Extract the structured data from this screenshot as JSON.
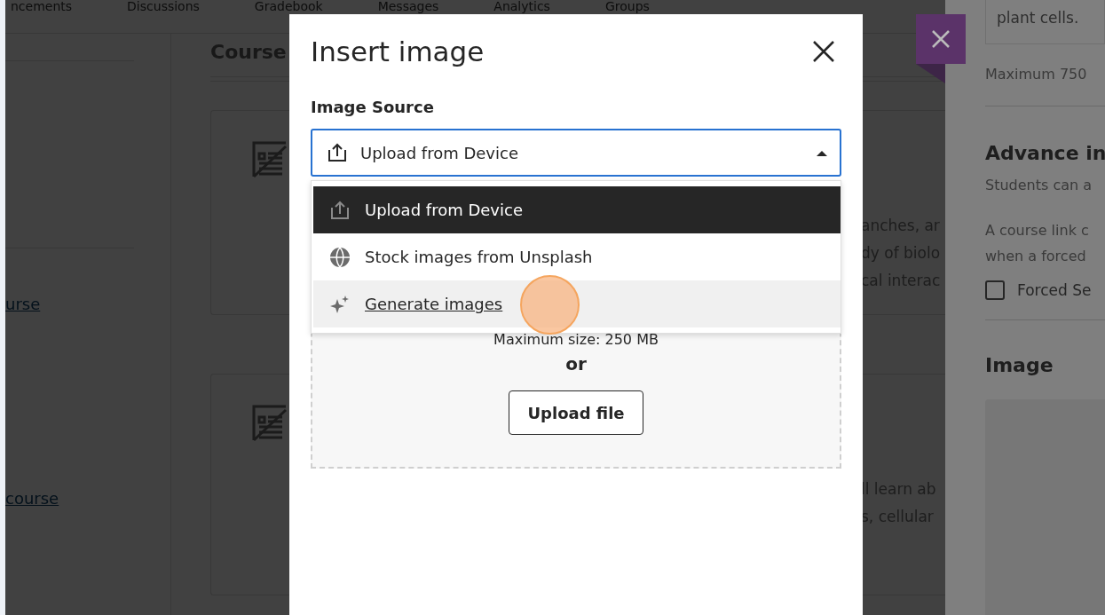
{
  "top_tabs": [
    "ncements",
    "Discussions",
    "Gradebook",
    "Messages",
    "Analytics",
    "Groups"
  ],
  "sidebar": {
    "links": [
      "urse",
      "course"
    ]
  },
  "main": {
    "heading": "Course",
    "cards": [
      {
        "lines": [
          "anches, ar",
          "dy of biolo",
          "cal interac"
        ]
      },
      {
        "lines": [
          "ll learn ab",
          "s, cellular"
        ]
      }
    ]
  },
  "modal": {
    "title": "Insert image",
    "source_label": "Image Source",
    "select": {
      "value": "Upload from Device"
    },
    "options": [
      {
        "label": "Upload from Device",
        "kind": "upload",
        "selected": true,
        "hovered": false
      },
      {
        "label": "Stock images from Unsplash",
        "kind": "globe",
        "selected": false,
        "hovered": false
      },
      {
        "label": "Generate images",
        "kind": "sparkle",
        "selected": false,
        "hovered": true
      }
    ],
    "dropzone": {
      "max_size": "Maximum size: 250 MB",
      "or": "or",
      "button": "Upload file"
    }
  },
  "panel": {
    "description_tail": "plant cells.",
    "char_limit": "Maximum 750",
    "section_heading": "Advance in",
    "section_text": "Students can a",
    "note_lines": [
      "A course link c",
      "when a forced"
    ],
    "checkbox": {
      "label": "Forced Se",
      "checked": false
    },
    "image_heading": "Image"
  }
}
